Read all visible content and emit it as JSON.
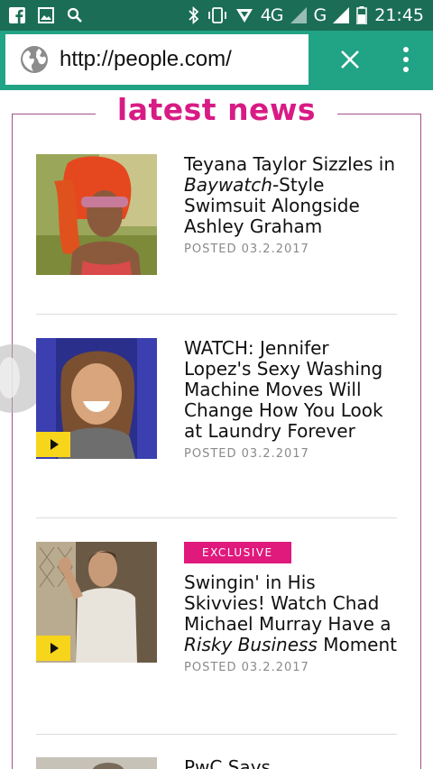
{
  "status_bar": {
    "network_label": "4G",
    "network_label_2": "G",
    "time": "21:45",
    "left_icons": [
      "facebook-icon",
      "gallery-icon",
      "search-icon"
    ],
    "right_icons": [
      "bluetooth-icon",
      "vibrate-icon",
      "hotspot-icon",
      "signal-icon",
      "battery-icon"
    ]
  },
  "browser": {
    "url": "http://people.com/",
    "close_icon": "close-icon",
    "menu_icon": "more-vert-icon"
  },
  "section": {
    "title": "latest news"
  },
  "articles": [
    {
      "title_part1": "Teyana Taylor Sizzles in ",
      "title_italic": "Baywatch",
      "title_part2": "-Style Swimsuit Alongside Ashley Graham",
      "posted": "POSTED 03.2.2017",
      "has_video": false
    },
    {
      "title": "WATCH: Jennifer Lopez's Sexy Washing Machine Moves Will Change How You Look at Laundry Forever",
      "posted": "POSTED 03.2.2017",
      "has_video": true
    },
    {
      "badge": "EXCLUSIVE",
      "title_part1": "Swingin' in His Skivvies! Watch Chad Michael Murray Have a ",
      "title_italic": "Risky Business",
      "title_part2": " Moment",
      "posted": "POSTED 03.2.2017",
      "has_video": true
    },
    {
      "title": "PwC Says"
    }
  ],
  "colors": {
    "status_bar": "#1b6e55",
    "url_bar": "#21a385",
    "accent_pink": "#d81b84",
    "frame_border": "#a35089",
    "badge_bg": "#e0197d",
    "play_yellow": "#f7d51b"
  }
}
